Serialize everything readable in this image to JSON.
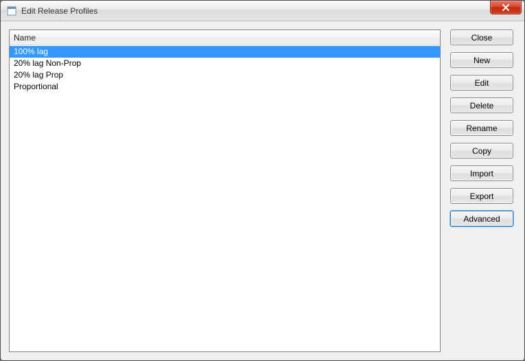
{
  "window": {
    "title": "Edit Release Profiles"
  },
  "list": {
    "header": "Name",
    "items": [
      {
        "label": "100% lag",
        "selected": true
      },
      {
        "label": "20% lag Non-Prop",
        "selected": false
      },
      {
        "label": "20% lag Prop",
        "selected": false
      },
      {
        "label": "Proportional",
        "selected": false
      }
    ]
  },
  "buttons": {
    "close": "Close",
    "new": "New",
    "edit": "Edit",
    "delete": "Delete",
    "rename": "Rename",
    "copy": "Copy",
    "import": "Import",
    "export": "Export",
    "advanced": "Advanced"
  },
  "colors": {
    "selection": "#3399ff",
    "close_button": "#c9381a"
  }
}
